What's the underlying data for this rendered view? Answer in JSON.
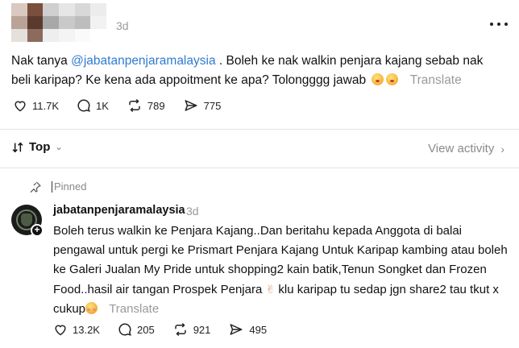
{
  "post": {
    "time": "3d",
    "body": {
      "part1": "Nak tanya ",
      "mention": "@jabatanpenjaramalaysia",
      "part2": " . Boleh ke nak walkin penjara kajang sebab nak beli karipap? Ke kena ada appoitment ke apa? Tolongggg jawab",
      "translate": "Translate"
    },
    "stats": {
      "likes": "11.7K",
      "comments": "1K",
      "reposts": "789",
      "shares": "775"
    }
  },
  "sort": {
    "label": "Top",
    "view_activity": "View activity"
  },
  "reply": {
    "pinned_label": "Pinned",
    "username": "jabatanpenjaramalaysia",
    "time": "3d",
    "body_part1": "Boleh terus walkin ke Penjara Kajang..Dan beritahu kepada Anggota di balai pengawal untuk pergi ke Prismart Penjara Kajang Untuk Karipap kambing atau boleh ke Galeri Jualan My Pride untuk shopping2 kain batik,Tenun Songket dan Frozen Food..hasil air tangan Prospek Penjara",
    "body_part2": " klu karipap tu sedap jgn share2 tau tkut x cukup",
    "translate": "Translate",
    "stats": {
      "likes": "13.2K",
      "comments": "205",
      "reposts": "921",
      "shares": "495"
    }
  },
  "colors": {
    "mention": "#2f7bd1",
    "muted": "#999999",
    "text": "#111111"
  }
}
